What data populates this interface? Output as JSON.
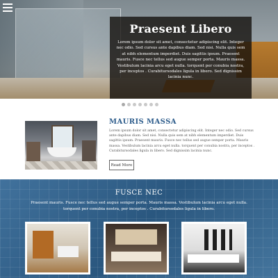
{
  "hero": {
    "title": "Praesent Libero",
    "text": "Lorem ipsum dolor sit amet, consectetur adipiscing elit. Integer nec odio. Sed cursus ante dapibus diam. Sed nisi. Nulla quis sem at nibh elementum imperdiet. Duis sagittis ipsum. Praesent mauris. Fusce nec tellus sed augue semper porta. Mauris massa. Vestibulum lacinia arcu eget nulla. torquent per conubia nostra, per inceptos . Curabitursodales ligula in libero. Sed dignissim lacinia nunc."
  },
  "slider": {
    "dot_count": 7,
    "active_index": 0
  },
  "feature": {
    "title": "MAURIS MASSA",
    "text": "Lorem ipsum dolor sit amet, consectetur adipiscing elit. Integer nec odio. Sed cursus ante dapibus diam. Sed nisi. Nulla quis sem at nibh elementum imperdiet. Duis sagittis ipsum. Praesent mauris. Fusce nec tellus sed augue semper porta. Mauris massa. Vestibulum lacinia arcu eget nulla. torquent per conubia nostra, per inceptos . Curabitursodales ligula in libero. Sed dignissim lacinia nunc.",
    "button_label": "Read More"
  },
  "section": {
    "title": "FUSCE NEC",
    "text": "Praesent mauris. Fusce nec tellus sed augue semper porta. Mauris massa. Vestibulum lacinia arcu eget nulla. torquent per conubia nostra, per inceptos . Curabitursodales ligula in libero."
  },
  "colors": {
    "accent_title": "#2e5d8c",
    "section_bg": "#2f5e86",
    "caption_bg": "#120e0a"
  },
  "icons": {
    "menu": "hamburger-menu-icon"
  }
}
